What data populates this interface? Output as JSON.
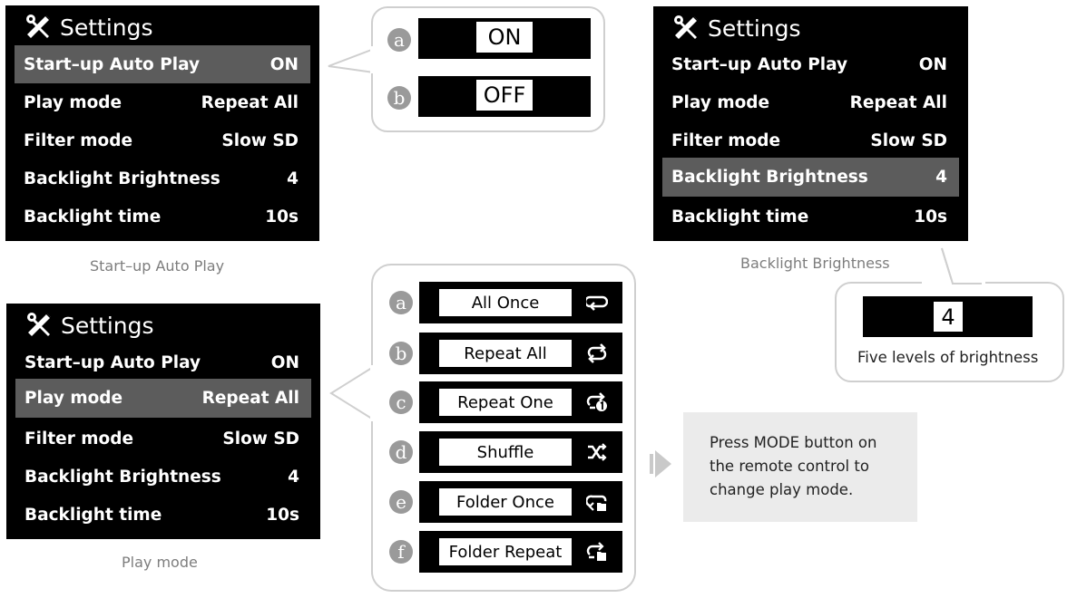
{
  "screens": {
    "s1": {
      "title": "Settings",
      "rows": [
        {
          "label": "Start–up Auto Play",
          "value": "ON"
        },
        {
          "label": "Play mode",
          "value": "Repeat All"
        },
        {
          "label": "Filter mode",
          "value": "Slow SD"
        },
        {
          "label": "Backlight Brightness",
          "value": "4"
        },
        {
          "label": "Backlight time",
          "value": "10s"
        }
      ],
      "caption": "Start–up Auto Play"
    },
    "s2": {
      "title": "Settings",
      "rows": [
        {
          "label": "Start–up Auto Play",
          "value": "ON"
        },
        {
          "label": "Play mode",
          "value": "Repeat All"
        },
        {
          "label": "Filter mode",
          "value": "Slow SD"
        },
        {
          "label": "Backlight Brightness",
          "value": "4"
        },
        {
          "label": "Backlight time",
          "value": "10s"
        }
      ],
      "caption": "Play mode"
    },
    "s3": {
      "title": "Settings",
      "rows": [
        {
          "label": "Start–up Auto Play",
          "value": "ON"
        },
        {
          "label": "Play mode",
          "value": "Repeat All"
        },
        {
          "label": "Filter mode",
          "value": "Slow SD"
        },
        {
          "label": "Backlight Brightness",
          "value": "4"
        },
        {
          "label": "Backlight time",
          "value": "10s"
        }
      ],
      "caption": "Backlight Brightness"
    }
  },
  "autoplay_options": [
    {
      "letter": "a",
      "label": "ON"
    },
    {
      "letter": "b",
      "label": "OFF"
    }
  ],
  "play_modes": [
    {
      "letter": "a",
      "label": "All Once",
      "icon": "all-once-icon"
    },
    {
      "letter": "b",
      "label": "Repeat All",
      "icon": "repeat-all-icon"
    },
    {
      "letter": "c",
      "label": "Repeat One",
      "icon": "repeat-one-icon"
    },
    {
      "letter": "d",
      "label": "Shuffle",
      "icon": "shuffle-icon"
    },
    {
      "letter": "e",
      "label": "Folder Once",
      "icon": "folder-once-icon"
    },
    {
      "letter": "f",
      "label": "Folder Repeat",
      "icon": "folder-repeat-icon"
    }
  ],
  "brightness": {
    "value": "4",
    "caption": "Five levels of brightness"
  },
  "note": {
    "text": "Press MODE button on the remote control to change play mode."
  },
  "colors": {
    "highlight": "#5c5c5c",
    "screen_bg": "#000000",
    "bubble_border": "#cfcfcf",
    "note_bg": "#ebebeb"
  }
}
